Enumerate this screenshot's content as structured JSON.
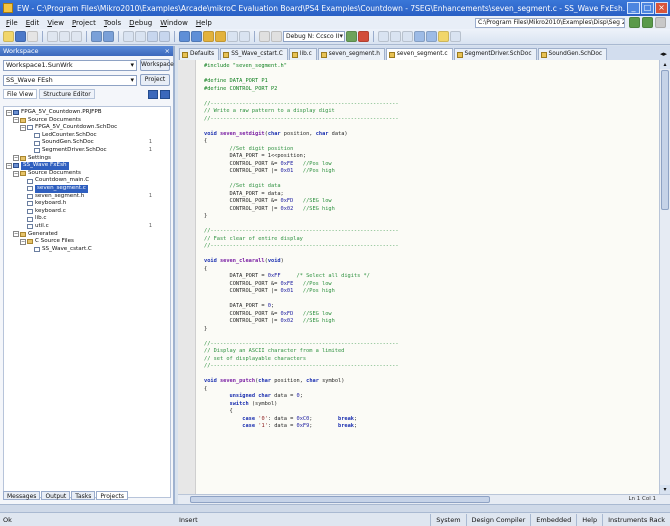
{
  "window": {
    "title": "EW - C:\\Program Files\\Mikro2010\\Examples\\Arcade\\mikroC Evaluation Board\\PS4 Examples\\Countdown - 7SEG\\Enhancements\\seven_segment.c - SS_Wave FxEsh. Licensed to Segment 7.0 (ss ...)"
  },
  "menubar": {
    "items": [
      "File",
      "Edit",
      "View",
      "Project",
      "Tools",
      "Debug",
      "Window",
      "Help"
    ],
    "path_box": "C:\\Program Files\\Mikro2010\\Examples\\Disp\\Seg 2.c"
  },
  "toolbar": {
    "config_combo": "Debug N: Ccsco II"
  },
  "left_panel": {
    "header": "Workspace",
    "workspace_combo": "Workspace1.SunWrk",
    "workspace_button": "Workspace",
    "project_combo": "SS_Wave FEsh",
    "project_button": "Project",
    "view_tabs": [
      "File View",
      "Structure Editor"
    ],
    "tree": [
      {
        "level": 0,
        "type": "proj",
        "label": "FPGA_5V_Countdown.PRJFPB",
        "expanded": true
      },
      {
        "level": 1,
        "type": "folder",
        "label": "Source Documents",
        "expanded": true
      },
      {
        "level": 2,
        "type": "file",
        "label": "FPGA_5V_Countdown.SchDoc",
        "expanded": true
      },
      {
        "level": 3,
        "type": "file",
        "label": "LedCounter.SchDoc"
      },
      {
        "level": 3,
        "type": "file",
        "label": "SoundGen.SchDoc",
        "badge": "1"
      },
      {
        "level": 3,
        "type": "file",
        "label": "SegmentDriver.SchDoc",
        "badge": "1"
      },
      {
        "level": 1,
        "type": "folder",
        "label": "Settings",
        "expanded": true
      },
      {
        "level": 0,
        "type": "proj",
        "label": "SS_Wave FxEsh",
        "expanded": true,
        "selected": true
      },
      {
        "level": 1,
        "type": "folder",
        "label": "Source Documents",
        "expanded": true
      },
      {
        "level": 2,
        "type": "file",
        "label": "Countdown_main.C"
      },
      {
        "level": 2,
        "type": "file",
        "label": "seven_segment.c",
        "selected": true
      },
      {
        "level": 2,
        "type": "file",
        "label": "seven_segment.h",
        "badge": "1"
      },
      {
        "level": 2,
        "type": "file",
        "label": "keyboard.h"
      },
      {
        "level": 2,
        "type": "file",
        "label": "keyboard.c"
      },
      {
        "level": 2,
        "type": "file",
        "label": "lib.c"
      },
      {
        "level": 2,
        "type": "file",
        "label": "util.c",
        "badge": "1"
      },
      {
        "level": 1,
        "type": "folder",
        "label": "Generated",
        "expanded": true
      },
      {
        "level": 2,
        "type": "folder",
        "label": "C Source Files",
        "expanded": true
      },
      {
        "level": 3,
        "type": "file",
        "label": "SS_Wave_cstart.C"
      }
    ],
    "bottom_tabs": [
      "Messages",
      "Output",
      "Tasks",
      "Projects"
    ]
  },
  "doc_tabs": [
    "Defaults",
    "SS_Wave_cstart.C",
    "lib.c",
    "seven_segment.h",
    "seven_segment.c",
    "SegmentDriver.SchDoc",
    "SoundGen.SchDoc"
  ],
  "active_doc_tab_index": 4,
  "code_lines": [
    [
      [
        "pp",
        "#include \"seven_segment.h\""
      ]
    ],
    [],
    [
      [
        "pp",
        "#define DATA_PORT P1"
      ]
    ],
    [
      [
        "pp",
        "#define CONTROL_PORT P2"
      ]
    ],
    [],
    [
      [
        "com",
        "//-----------------------------------------------------------"
      ]
    ],
    [
      [
        "com",
        "// Write a raw pattern to a display digit"
      ]
    ],
    [
      [
        "com",
        "//-----------------------------------------------------------"
      ]
    ],
    [],
    [
      [
        "kw",
        "void"
      ],
      [
        "t",
        " "
      ],
      [
        "def",
        "seven_setdigit"
      ],
      [
        "t",
        "("
      ],
      [
        "kw",
        "char"
      ],
      [
        "t",
        " position, "
      ],
      [
        "kw",
        "char"
      ],
      [
        "t",
        " data)"
      ]
    ],
    [
      [
        "t",
        "{"
      ]
    ],
    [
      [
        "t",
        "        "
      ],
      [
        "com",
        "//Set digit position"
      ]
    ],
    [
      [
        "t",
        "        DATA_PORT = 1<<position;"
      ]
    ],
    [
      [
        "t",
        "        CONTROL_PORT &= "
      ],
      [
        "num",
        "0xFE"
      ],
      [
        "t",
        "   "
      ],
      [
        "com",
        "//Pos low"
      ]
    ],
    [
      [
        "t",
        "        CONTROL_PORT |= "
      ],
      [
        "num",
        "0x01"
      ],
      [
        "t",
        "   "
      ],
      [
        "com",
        "//Pos high"
      ]
    ],
    [],
    [
      [
        "t",
        "        "
      ],
      [
        "com",
        "//Set digit data"
      ]
    ],
    [
      [
        "t",
        "        DATA_PORT = data;"
      ]
    ],
    [
      [
        "t",
        "        CONTROL_PORT &= "
      ],
      [
        "num",
        "0xFD"
      ],
      [
        "t",
        "   "
      ],
      [
        "com",
        "//SEG low"
      ]
    ],
    [
      [
        "t",
        "        CONTROL_PORT |= "
      ],
      [
        "num",
        "0x02"
      ],
      [
        "t",
        "   "
      ],
      [
        "com",
        "//SEG high"
      ]
    ],
    [
      [
        "t",
        "}"
      ]
    ],
    [],
    [
      [
        "com",
        "//-----------------------------------------------------------"
      ]
    ],
    [
      [
        "com",
        "// Fast clear of entire display"
      ]
    ],
    [
      [
        "com",
        "//-----------------------------------------------------------"
      ]
    ],
    [],
    [
      [
        "kw",
        "void"
      ],
      [
        "t",
        " "
      ],
      [
        "def",
        "seven_clearall"
      ],
      [
        "t",
        "("
      ],
      [
        "kw",
        "void"
      ],
      [
        "t",
        ")"
      ]
    ],
    [
      [
        "t",
        "{"
      ]
    ],
    [
      [
        "t",
        "        DATA_PORT = "
      ],
      [
        "num",
        "0xFF"
      ],
      [
        "t",
        "     "
      ],
      [
        "com",
        "/* Select all digits */"
      ]
    ],
    [
      [
        "t",
        "        CONTROL_PORT &= "
      ],
      [
        "num",
        "0xFE"
      ],
      [
        "t",
        "   "
      ],
      [
        "com",
        "//Pos low"
      ]
    ],
    [
      [
        "t",
        "        CONTROL_PORT |= "
      ],
      [
        "num",
        "0x01"
      ],
      [
        "t",
        "   "
      ],
      [
        "com",
        "//Pos high"
      ]
    ],
    [],
    [
      [
        "t",
        "        DATA_PORT = "
      ],
      [
        "num",
        "0"
      ],
      [
        "t",
        ";"
      ]
    ],
    [
      [
        "t",
        "        CONTROL_PORT &= "
      ],
      [
        "num",
        "0xFD"
      ],
      [
        "t",
        "   "
      ],
      [
        "com",
        "//SEG low"
      ]
    ],
    [
      [
        "t",
        "        CONTROL_PORT |= "
      ],
      [
        "num",
        "0x02"
      ],
      [
        "t",
        "   "
      ],
      [
        "com",
        "//SEG high"
      ]
    ],
    [
      [
        "t",
        "}"
      ]
    ],
    [],
    [
      [
        "com",
        "//-----------------------------------------------------------"
      ]
    ],
    [
      [
        "com",
        "// Display an ASCII character from a limited"
      ]
    ],
    [
      [
        "com",
        "// set of displayable characters"
      ]
    ],
    [
      [
        "com",
        "//-----------------------------------------------------------"
      ]
    ],
    [],
    [
      [
        "kw",
        "void"
      ],
      [
        "t",
        " "
      ],
      [
        "def",
        "seven_putch"
      ],
      [
        "t",
        "("
      ],
      [
        "kw",
        "char"
      ],
      [
        "t",
        " position, "
      ],
      [
        "kw",
        "char"
      ],
      [
        "t",
        " symbol)"
      ]
    ],
    [
      [
        "t",
        "{"
      ]
    ],
    [
      [
        "t",
        "        "
      ],
      [
        "kw",
        "unsigned char"
      ],
      [
        "t",
        " data = "
      ],
      [
        "num",
        "0"
      ],
      [
        "t",
        ";"
      ]
    ],
    [
      [
        "t",
        "        "
      ],
      [
        "kw",
        "switch"
      ],
      [
        "t",
        " (symbol)"
      ]
    ],
    [
      [
        "t",
        "        {"
      ]
    ],
    [
      [
        "t",
        "            "
      ],
      [
        "kw",
        "case"
      ],
      [
        "t",
        " "
      ],
      [
        "str",
        "'0'"
      ],
      [
        "t",
        ": data = "
      ],
      [
        "num",
        "0xC0"
      ],
      [
        "t",
        ";        "
      ],
      [
        "kw",
        "break"
      ],
      [
        "t",
        ";"
      ]
    ],
    [
      [
        "t",
        "            "
      ],
      [
        "kw",
        "case"
      ],
      [
        "t",
        " "
      ],
      [
        "str",
        "'1'"
      ],
      [
        "t",
        ": data = "
      ],
      [
        "num",
        "0xF9"
      ],
      [
        "t",
        ";        "
      ],
      [
        "kw",
        "break"
      ],
      [
        "t",
        ";"
      ]
    ]
  ],
  "hscroll_info": "Ln 1   Col 1",
  "status": {
    "message": "Ok",
    "mode": "Insert",
    "cells": [
      "System",
      "Design Compiler",
      "Embedded",
      "Help",
      "Instruments Rack"
    ]
  },
  "colors": {
    "titlebar": "#2a5fc4",
    "selection": "#2f5fbf",
    "keyword": "#1b2fb0",
    "comment": "#2a8f3c",
    "preprocessor": "#0a7d1a"
  }
}
